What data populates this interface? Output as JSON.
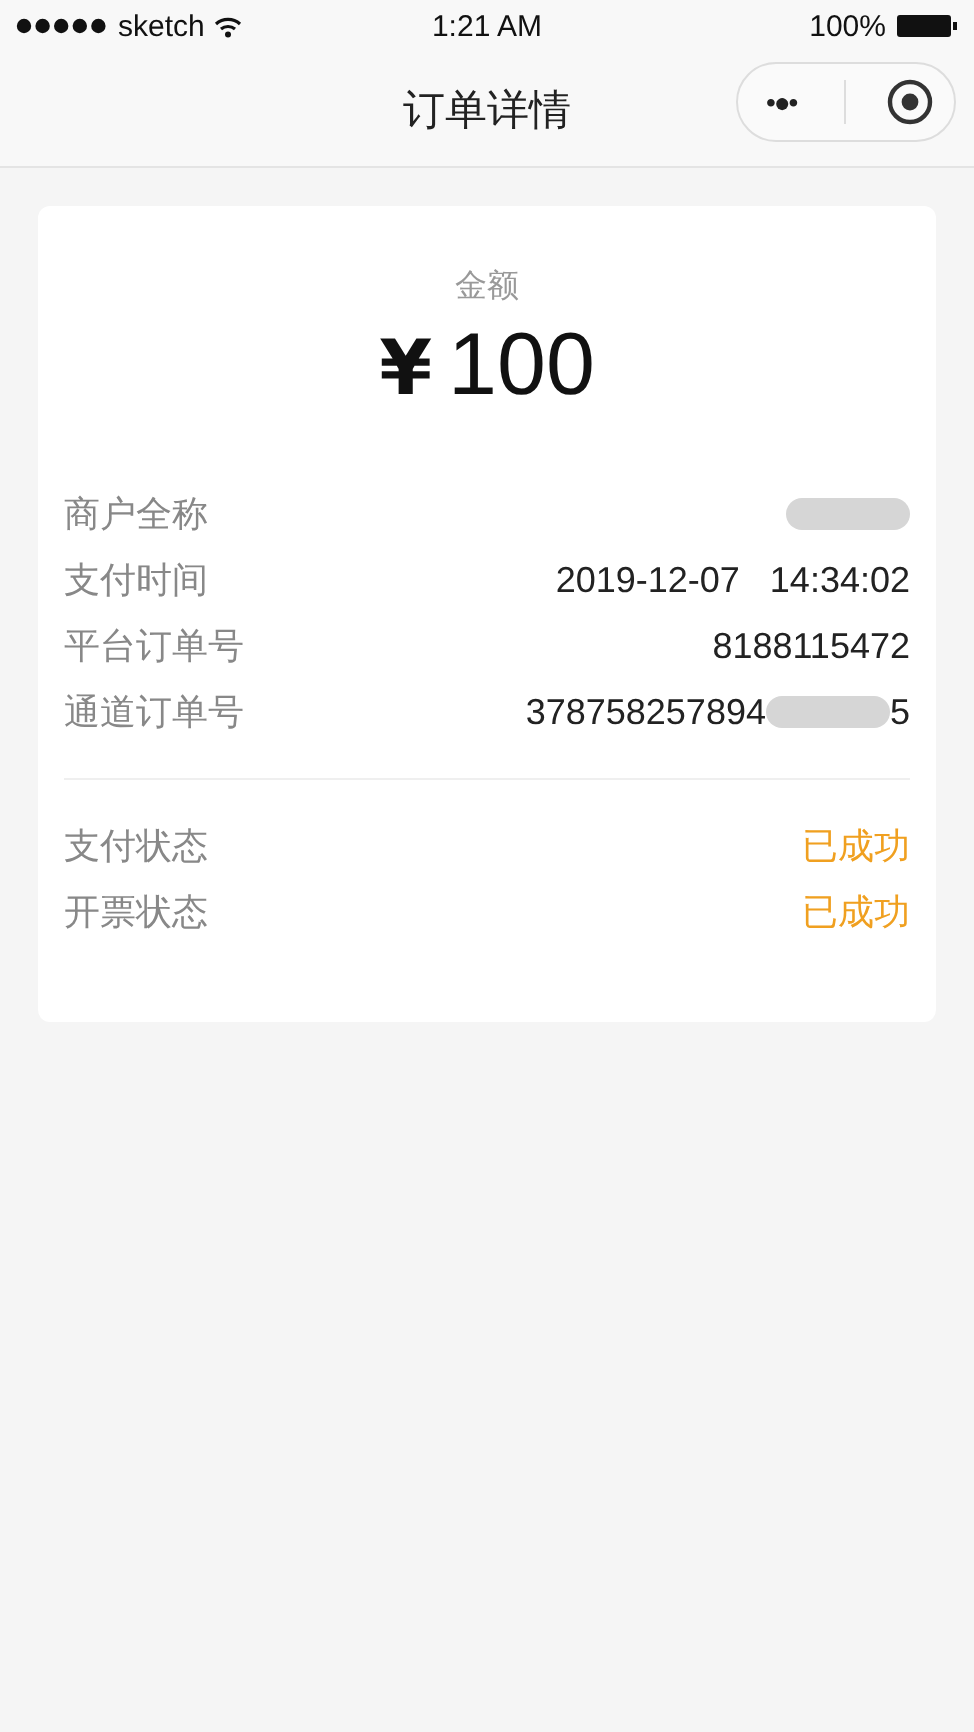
{
  "status_bar": {
    "carrier": "sketch",
    "time": "1:21 AM",
    "battery": "100%"
  },
  "nav": {
    "title": "订单详情",
    "menu_icon": "•●•"
  },
  "amount": {
    "label": "金额",
    "currency": "¥",
    "value": "100"
  },
  "details": [
    {
      "label": "商户全称",
      "redacted": true
    },
    {
      "label": "支付时间",
      "value": "2019-12-07   14:34:02",
      "redacted": false
    },
    {
      "label": "平台订单号",
      "value": "8188115472",
      "redacted": false
    },
    {
      "label": "通道订单号",
      "value": "378758257894",
      "redacted": true,
      "value_end": "5"
    }
  ],
  "statuses": [
    {
      "label": "支付状态",
      "value": "已成功",
      "kind": "success"
    },
    {
      "label": "开票状态",
      "value": "已成功",
      "kind": "success"
    }
  ]
}
